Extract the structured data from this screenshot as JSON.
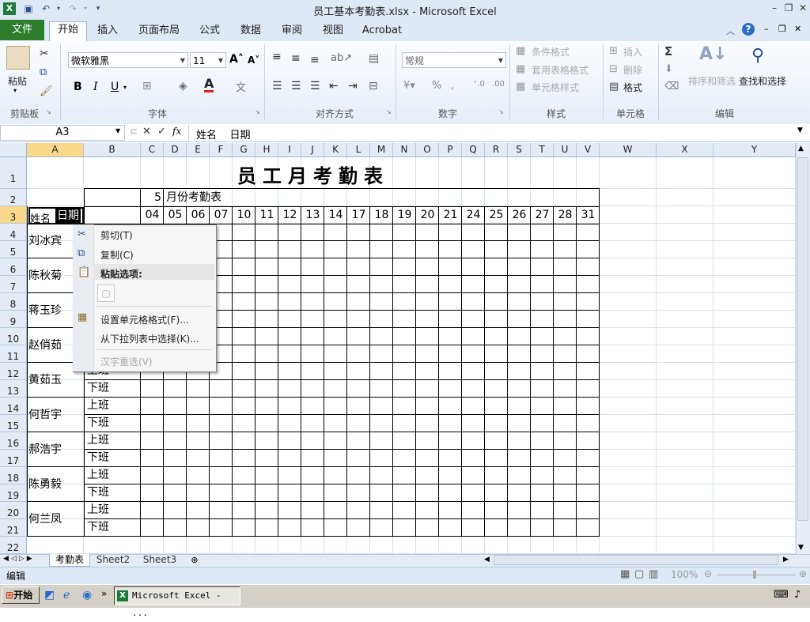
{
  "window": {
    "title": "员工基本考勤表.xlsx - Microsoft Excel"
  },
  "tabs": {
    "file": "文件",
    "items": [
      "开始",
      "插入",
      "页面布局",
      "公式",
      "数据",
      "审阅",
      "视图",
      "Acrobat"
    ]
  },
  "ribbon": {
    "paste": "粘贴",
    "font_name": "微软雅黑",
    "font_size": "11",
    "number_format": "常规",
    "cond_format": "条件格式",
    "table_format": "套用表格格式",
    "cell_style": "单元格样式",
    "insert": "插入",
    "delete": "删除",
    "format": "格式",
    "sort_filter": "排序和筛选",
    "find_select": "查找和选择",
    "groups": {
      "clipboard": "剪贴板",
      "font": "字体",
      "align": "对齐方式",
      "number": "数字",
      "styles": "样式",
      "cells": "单元格",
      "edit": "编辑"
    },
    "bold": "B",
    "italic": "I",
    "underline": "U"
  },
  "formula_bar": {
    "name_box": "A3",
    "fx": "fx",
    "value": "姓名    日期"
  },
  "columns": [
    "A",
    "B",
    "C",
    "D",
    "E",
    "F",
    "G",
    "H",
    "I",
    "J",
    "K",
    "L",
    "M",
    "N",
    "O",
    "P",
    "Q",
    "R",
    "S",
    "T",
    "U",
    "V",
    "W",
    "X",
    "Y"
  ],
  "rows": [
    "1",
    "2",
    "3",
    "4",
    "5",
    "6",
    "7",
    "8",
    "9",
    "10",
    "11",
    "12",
    "13",
    "14",
    "15",
    "16",
    "17",
    "18",
    "19",
    "20",
    "21",
    "22"
  ],
  "sheet": {
    "title": "员工月考勤表",
    "month_num": "5",
    "month_label": "月份考勤表",
    "name_label": "姓名",
    "date_label": "日期",
    "days": [
      "04",
      "05",
      "06",
      "07",
      "10",
      "11",
      "12",
      "13",
      "14",
      "17",
      "18",
      "19",
      "20",
      "21",
      "24",
      "25",
      "26",
      "27",
      "28",
      "31"
    ],
    "employees": [
      "刘冰宾",
      "陈秋菊",
      "蒋玉珍",
      "赵俏茹",
      "黄茹玉",
      "何哲宇",
      "郝浩宇",
      "陈勇毅",
      "何兰凤"
    ],
    "on_duty": "上班",
    "off_duty": "下班"
  },
  "context_menu": {
    "cut": "剪切(T)",
    "copy": "复制(C)",
    "paste_options": "粘贴选项:",
    "format_cells": "设置单元格格式(F)...",
    "pick_from_list": "从下拉列表中选择(K)...",
    "hanzi_reselect": "汉字重选(V)"
  },
  "sheet_tabs": [
    "考勤表",
    "Sheet2",
    "Sheet3"
  ],
  "status": {
    "mode": "编辑",
    "zoom": "100%"
  },
  "taskbar": {
    "start": "开始",
    "window_button": "Microsoft Excel - ..."
  }
}
